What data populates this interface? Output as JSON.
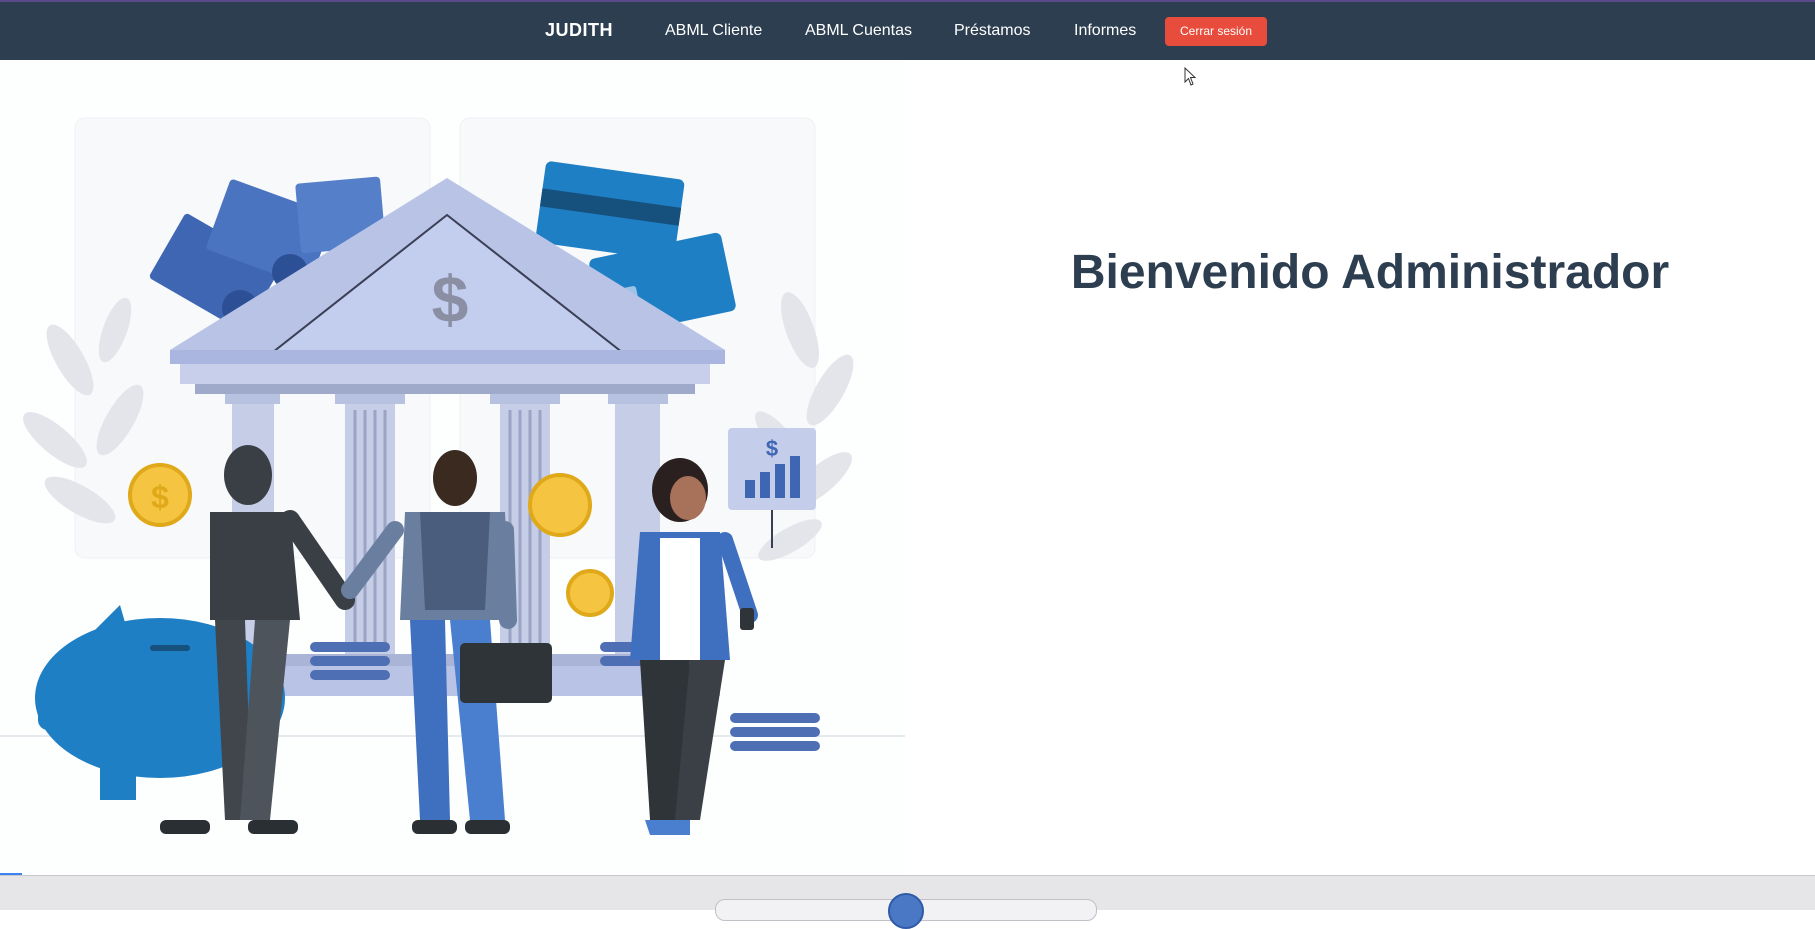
{
  "navbar": {
    "brand": "JUDITH",
    "links": [
      {
        "label": "ABML Cliente"
      },
      {
        "label": "ABML Cuentas"
      },
      {
        "label": "Préstamos"
      },
      {
        "label": "Informes"
      }
    ],
    "logout_label": "Cerrar sesión",
    "colors": {
      "background": "#2c3e50",
      "logout": "#e74c3c"
    }
  },
  "main": {
    "welcome_title": "Bienvenido Administrador",
    "hero_image": "bank-illustration",
    "hero_symbols": {
      "bank_sign": "$",
      "chart_sign": "$",
      "coin_sign": "$"
    }
  },
  "colors": {
    "title": "#2c3e50",
    "accent_blue": "#1f7fc4"
  }
}
